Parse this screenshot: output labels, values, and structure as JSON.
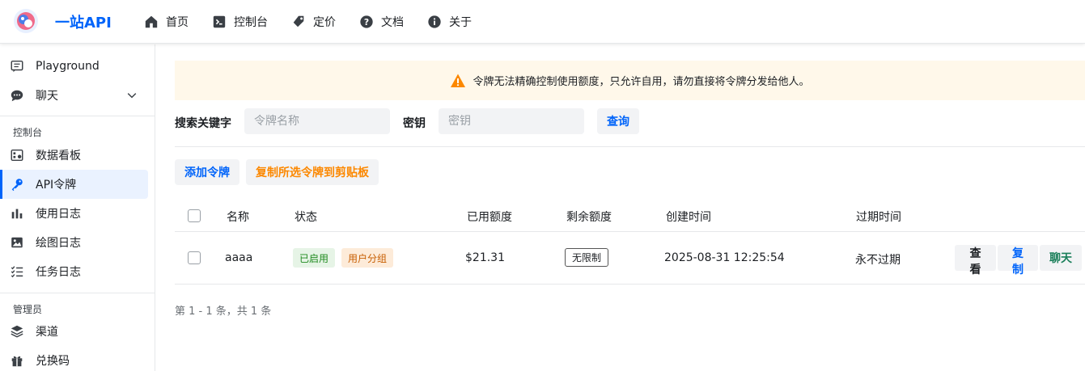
{
  "header": {
    "brand": "一站API",
    "nav": [
      {
        "label": "首页",
        "icon": "home-icon"
      },
      {
        "label": "控制台",
        "icon": "terminal-icon"
      },
      {
        "label": "定价",
        "icon": "tag-icon"
      },
      {
        "label": "文档",
        "icon": "help-circle-icon"
      },
      {
        "label": "关于",
        "icon": "info-circle-icon"
      }
    ]
  },
  "sidebar": {
    "items_top": [
      {
        "label": "Playground",
        "icon": "comment-icon"
      },
      {
        "label": "聊天",
        "icon": "chat-bubble-icon"
      }
    ],
    "section_console": "控制台",
    "items_console": [
      {
        "label": "数据看板",
        "icon": "dashboard-icon"
      },
      {
        "label": "API令牌",
        "icon": "key-icon",
        "active": true
      },
      {
        "label": "使用日志",
        "icon": "bar-chart-icon"
      },
      {
        "label": "绘图日志",
        "icon": "image-icon"
      },
      {
        "label": "任务日志",
        "icon": "checklist-icon"
      }
    ],
    "section_admin": "管理员",
    "items_admin": [
      {
        "label": "渠道",
        "icon": "layers-icon"
      },
      {
        "label": "兑换码",
        "icon": "gift-icon"
      }
    ]
  },
  "notice": {
    "text": "令牌无法精确控制使用额度，只允许自用，请勿直接将令牌分发给他人。",
    "icon": "warning-triangle-icon",
    "color": "#fc8800"
  },
  "search": {
    "keyword_label": "搜索关键字",
    "keyword_placeholder": "令牌名称",
    "key_label": "密钥",
    "key_placeholder": "密钥",
    "query_button": "查询"
  },
  "actions": {
    "add_token": "添加令牌",
    "copy_selected": "复制所选令牌到剪贴板"
  },
  "table": {
    "columns": [
      "名称",
      "状态",
      "已用额度",
      "剩余额度",
      "创建时间",
      "过期时间"
    ],
    "rows": [
      {
        "name": "aaaa",
        "status": "已启用",
        "group": "用户分组",
        "used": "$21.31",
        "remaining": "无限制",
        "created": "2025-08-31 12:25:54",
        "expires": "永不过期",
        "actions": [
          "查看",
          "复制",
          "聊天"
        ]
      }
    ]
  },
  "pagination": {
    "summary": "第 1 - 1 条，共 1 条"
  },
  "colors": {
    "accent": "#0064fa",
    "warning": "#fc8800",
    "success_text": "#1f8a1f",
    "chat_text": "#1a7f5a"
  }
}
